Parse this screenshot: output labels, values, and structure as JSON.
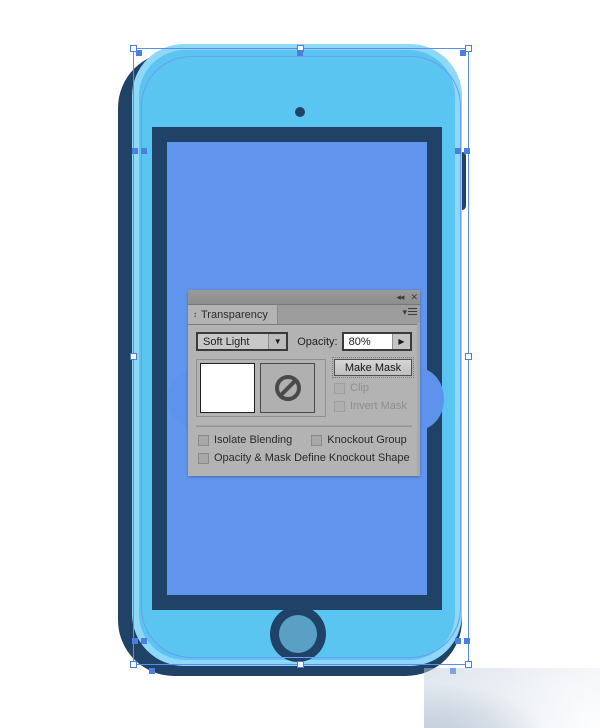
{
  "app": {
    "document_title": "Transparency"
  },
  "panel": {
    "title": "Transparency",
    "tab_collapse_icon": "double-chevron-up-icon",
    "topbar": {
      "collapse_icon_label": "◂◂",
      "close_icon_label": "✕"
    },
    "menu_icon_label": "▾",
    "blend_mode": {
      "selected": "Soft Light",
      "arrow": "▼"
    },
    "opacity": {
      "label": "Opacity:",
      "value": "80%",
      "arrow": "▶"
    },
    "thumbnails": {
      "artwork_name": "artwork-thumbnail",
      "mask_name": "mask-thumbnail",
      "mask_state_icon": "no-mask-icon"
    },
    "make_mask_button": "Make Mask",
    "clip_checkbox": {
      "label": "Clip",
      "checked": false,
      "enabled": false
    },
    "invert_mask_checkbox": {
      "label": "Invert Mask",
      "checked": false,
      "enabled": false
    },
    "isolate_blending_checkbox": {
      "label": "Isolate Blending",
      "checked": false,
      "enabled": true
    },
    "knockout_group_checkbox": {
      "label": "Knockout Group",
      "checked": false,
      "enabled": true
    },
    "opacity_mask_knockout_checkbox": {
      "label": "Opacity & Mask Define Knockout Shape",
      "checked": false,
      "enabled": true
    }
  },
  "artwork": {
    "name": "smartphone-illustration",
    "colors": {
      "body_dark": "#1f4266",
      "body_highlight": "#8fd8f7",
      "face": "#5bc5f2",
      "bezel": "#1f4266",
      "screen": "#6296ee",
      "home_button_ring": "#1f4266",
      "home_button_fill": "#5aa0c4",
      "canvas_background": "#ffffff"
    },
    "selection": {
      "handle_color": "#ffffff",
      "anchor_color": "#4a7fe0",
      "path_color": "#6f9bf0"
    }
  }
}
